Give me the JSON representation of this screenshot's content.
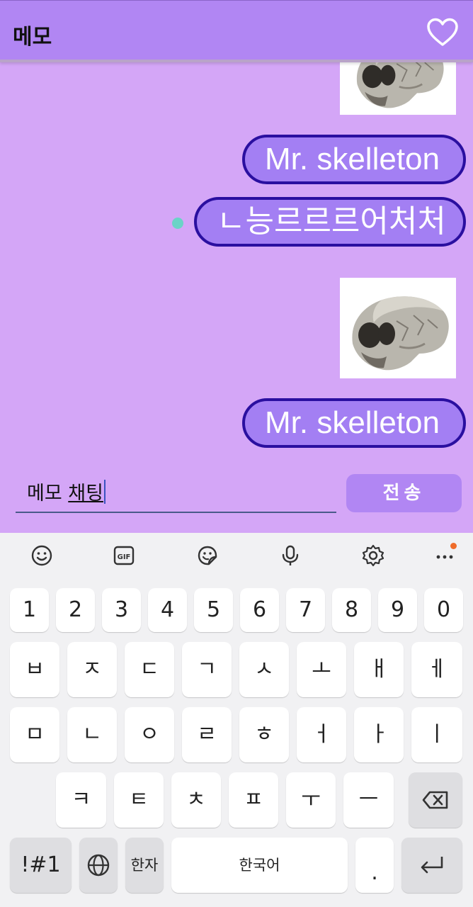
{
  "app_bar": {
    "title": "메모",
    "favorite_icon": "heart-outline-icon"
  },
  "messages": [
    {
      "type": "image",
      "alt": "skull"
    },
    {
      "type": "text",
      "text": "Mr. skelleton"
    },
    {
      "type": "text",
      "text": "ㄴ능르르르어처처",
      "unread_dot": true
    },
    {
      "type": "image",
      "alt": "skull"
    },
    {
      "type": "text",
      "text": "Mr. skelleton"
    }
  ],
  "input": {
    "committed": "메모 ",
    "composing": "채팅"
  },
  "send_button": {
    "label": "전송"
  },
  "keyboard": {
    "toolbar": [
      "emoji-icon",
      "gif-icon",
      "sticker-icon",
      "microphone-icon",
      "settings-gear-icon",
      "more-dots-icon"
    ],
    "row_numbers": [
      "1",
      "2",
      "3",
      "4",
      "5",
      "6",
      "7",
      "8",
      "9",
      "0"
    ],
    "row_1": [
      "ㅂ",
      "ㅈ",
      "ㄷ",
      "ㄱ",
      "ㅅ",
      "ㅗ",
      "ㅐ",
      "ㅔ"
    ],
    "row_2": [
      "ㅁ",
      "ㄴ",
      "ㅇ",
      "ㄹ",
      "ㅎ",
      "ㅓ",
      "ㅏ",
      "ㅣ"
    ],
    "row_3": [
      "ㅋ",
      "ㅌ",
      "ㅊ",
      "ㅍ",
      "ㅜ",
      "ㅡ"
    ],
    "symbols_label": "!#1",
    "hanja_label": "한자",
    "space_label": "한국어",
    "period_label": "."
  },
  "colors": {
    "app_bar": "#b186f3",
    "chat_background": "#d4a6f7",
    "bubble_fill": "#a37ff3",
    "bubble_border": "#2a0fa0",
    "unread_dot": "#6ad3c7",
    "send_button": "#b186f3"
  }
}
